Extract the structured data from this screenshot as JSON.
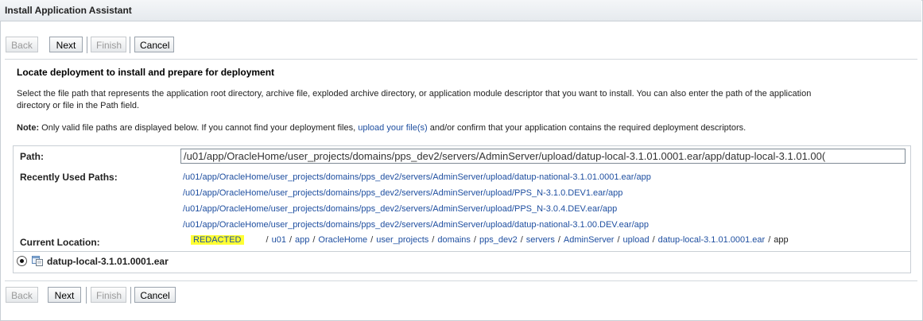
{
  "window": {
    "title": "Install Application Assistant"
  },
  "buttons": {
    "back": "Back",
    "next": "Next",
    "finish": "Finish",
    "cancel": "Cancel"
  },
  "section": {
    "heading": "Locate deployment to install and prepare for deployment",
    "description_line1": "Select the file path that represents the application root directory, archive file, exploded archive directory, or application module descriptor that you want to install. You can also enter the path of the application",
    "description_line2": "directory or file in the Path field.",
    "note_label": "Note:",
    "note_before": " Only valid file paths are displayed below. If you cannot find your deployment files,",
    "note_link": "upload your file(s)",
    "note_after": " and/or confirm that your application contains the required deployment descriptors."
  },
  "form": {
    "path_label": "Path:",
    "path_value": "/u01/app/OracleHome/user_projects/domains/pps_dev2/servers/AdminServer/upload/datup-local-3.1.01.0001.ear/app/datup-local-3.1.01.00(",
    "recent_label": "Recently Used Paths:",
    "recent_paths": [
      "/u01/app/OracleHome/user_projects/domains/pps_dev2/servers/AdminServer/upload/datup-national-3.1.01.0001.ear/app",
      "/u01/app/OracleHome/user_projects/domains/pps_dev2/servers/AdminServer/upload/PPS_N-3.1.0.DEV1.ear/app",
      "/u01/app/OracleHome/user_projects/domains/pps_dev2/servers/AdminServer/upload/PPS_N-3.0.4.DEV.ear/app",
      "/u01/app/OracleHome/user_projects/domains/pps_dev2/servers/AdminServer/upload/datup-national-3.1.00.DEV.ear/app"
    ],
    "location_label": "Current Location:",
    "location_redacted": "REDACTED",
    "location_crumbs": [
      "u01",
      "app",
      "OracleHome",
      "user_projects",
      "domains",
      "pps_dev2",
      "servers",
      "AdminServer",
      "upload",
      "datup-local-3.1.01.0001.ear"
    ],
    "location_current": "app"
  },
  "selection": {
    "archive_name": "datup-local-3.1.01.0001.ear",
    "icon": "archive-file-icon"
  }
}
